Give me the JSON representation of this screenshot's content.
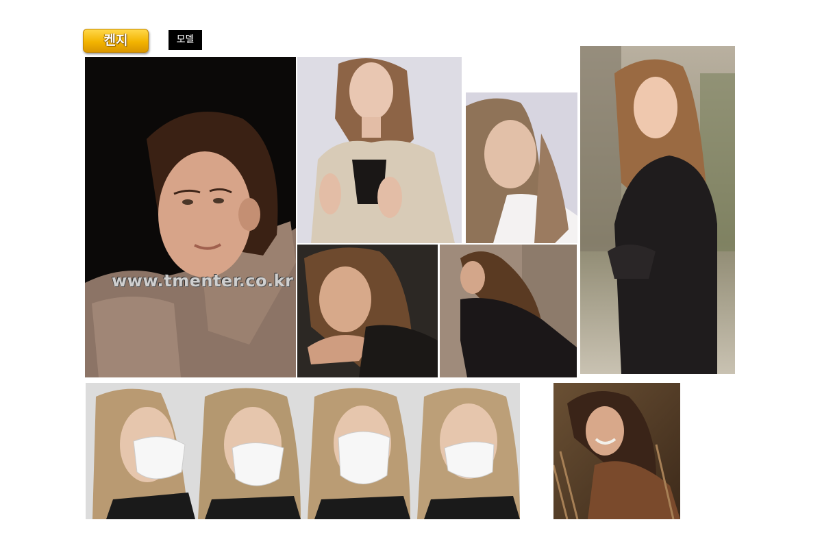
{
  "header": {
    "name_label": "켄지",
    "category_label": "모델"
  },
  "watermark": "www.tmenter.co.kr",
  "colors": {
    "button_gold": "#f3b400",
    "tag_black": "#000000"
  },
  "photos": [
    {
      "name": "portrait-puffer-jacket"
    },
    {
      "name": "portrait-beige-blazer"
    },
    {
      "name": "portrait-closeup-gray"
    },
    {
      "name": "portrait-street-smiling"
    },
    {
      "name": "portrait-hand-on-chin"
    },
    {
      "name": "portrait-seated-profile"
    },
    {
      "name": "mask-photo-strip"
    },
    {
      "name": "portrait-laughing-outdoor"
    }
  ]
}
